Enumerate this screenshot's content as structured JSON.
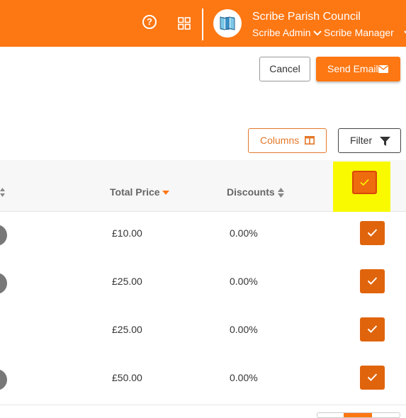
{
  "header": {
    "council_name": "Scribe Parish Council",
    "role_primary": "Scribe Admin",
    "role_secondary": "Scribe Manager",
    "help_symbol": "?",
    "accent_color": "#fd7713"
  },
  "actions": {
    "cancel_label": "Cancel",
    "send_email_label": "Send Email"
  },
  "toolbar": {
    "columns_label": "Columns",
    "filter_label": "Filter"
  },
  "table": {
    "headers": {
      "total_price": "Total Price",
      "discounts": "Discounts"
    },
    "select_all_checked": true,
    "rows": [
      {
        "total_price": "£10.00",
        "discount": "0.00%",
        "checked": true
      },
      {
        "total_price": "£25.00",
        "discount": "0.00%",
        "checked": true
      },
      {
        "total_price": "£25.00",
        "discount": "0.00%",
        "checked": true
      },
      {
        "total_price": "£50.00",
        "discount": "0.00%",
        "checked": true
      }
    ]
  }
}
